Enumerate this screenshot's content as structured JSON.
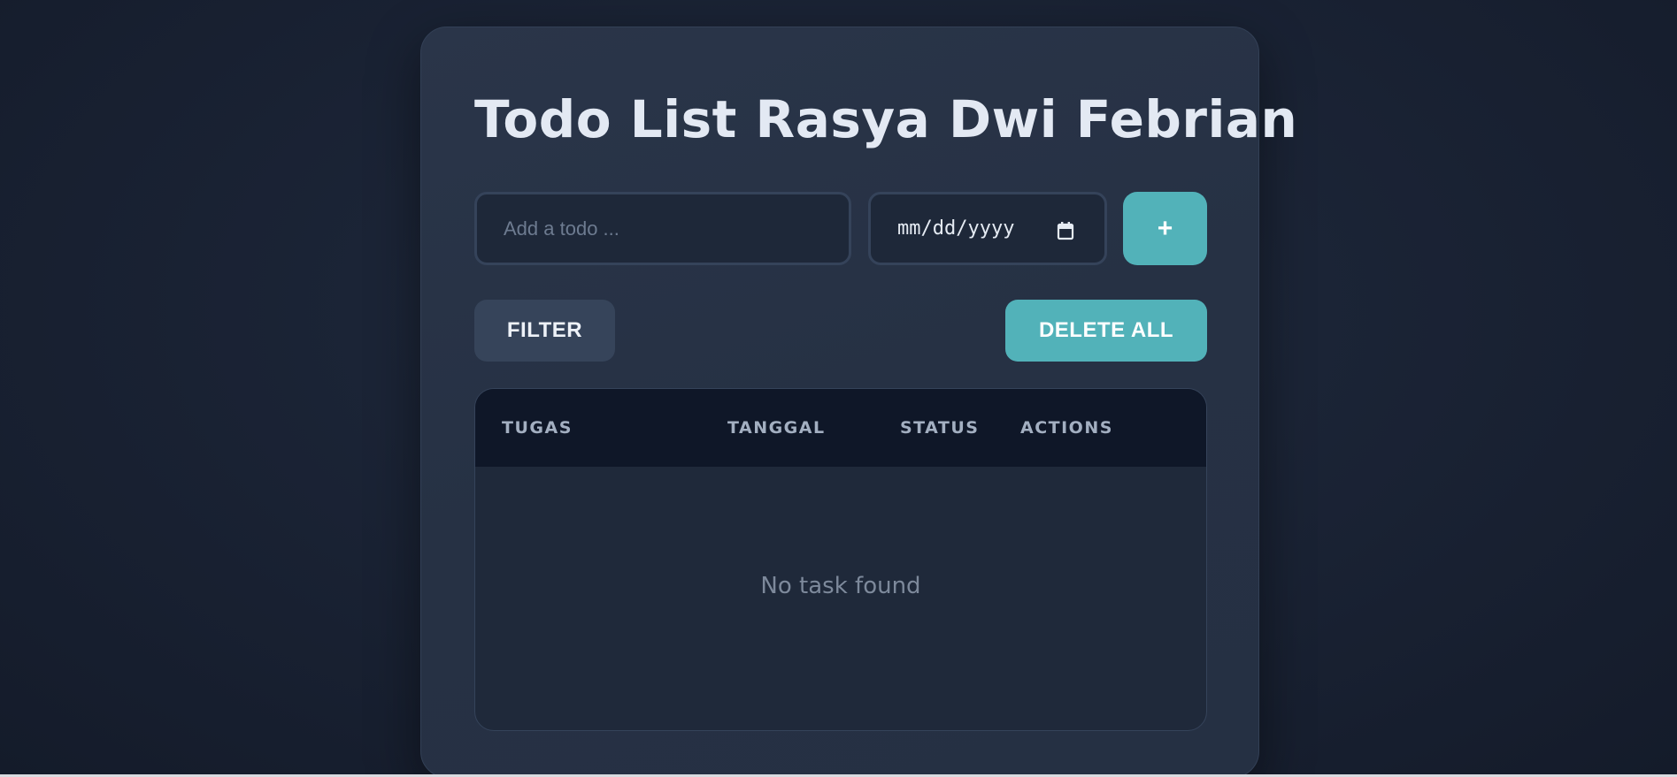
{
  "app": {
    "title": "Todo List Rasya Dwi Febrian"
  },
  "form": {
    "todo_placeholder": "Add a todo ...",
    "todo_value": "",
    "date_placeholder": "mm/dd/yyyy",
    "add_label": "+"
  },
  "toolbar": {
    "filter_label": "FILTER",
    "delete_all_label": "DELETE ALL"
  },
  "table": {
    "columns": [
      "TUGAS",
      "TANGGAL",
      "STATUS",
      "ACTIONS"
    ],
    "rows": [],
    "empty_message": "No task found"
  },
  "colors": {
    "accent": "#52b2b9",
    "card": "#263144",
    "background": "#1a2233",
    "header": "#0f1728"
  },
  "icons": {
    "date_picker": "calendar-icon"
  }
}
